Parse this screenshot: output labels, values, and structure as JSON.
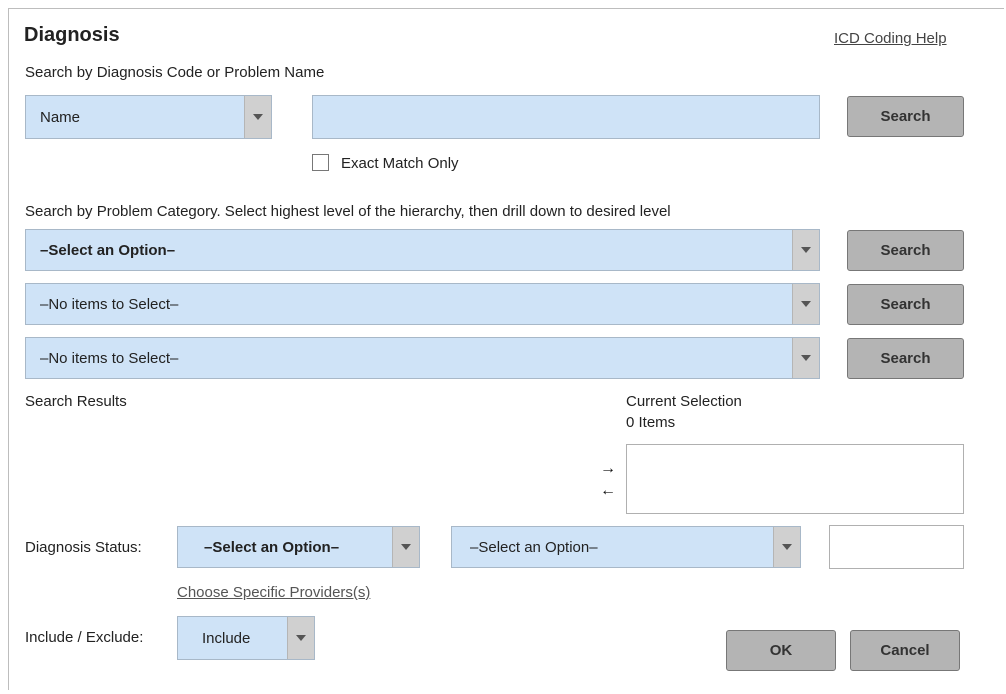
{
  "dialog": {
    "title": "Diagnosis",
    "help_link": "ICD Coding Help"
  },
  "search_code": {
    "label": "Search by Diagnosis Code or Problem Name",
    "type_select": "Name",
    "query": "",
    "search_label": "Search",
    "exact_match_label": "Exact Match Only",
    "exact_match_checked": false
  },
  "category": {
    "label": "Search by Problem Category. Select highest level of the hierarchy, then drill down to desired level",
    "levels": [
      {
        "value": "–Select an Option–",
        "search_label": "Search"
      },
      {
        "value": "–No items to Select–",
        "search_label": "Search"
      },
      {
        "value": "–No items to Select–",
        "search_label": "Search"
      }
    ]
  },
  "results": {
    "label": "Search Results",
    "current_selection_label": "Current Selection",
    "current_selection_count": "0 Items",
    "add_arrow": "→",
    "remove_arrow": "←"
  },
  "status": {
    "label": "Diagnosis Status:",
    "primary_select": "–Select an Option–",
    "secondary_select": "–Select an Option–",
    "value": ""
  },
  "providers_link": "Choose Specific Providers(s)",
  "include": {
    "label": "Include / Exclude:",
    "value": "Include"
  },
  "footer": {
    "ok_label": "OK",
    "cancel_label": "Cancel"
  },
  "colors": {
    "field_bg": "#cfe3f7",
    "button_bg": "#b4b4b4"
  }
}
